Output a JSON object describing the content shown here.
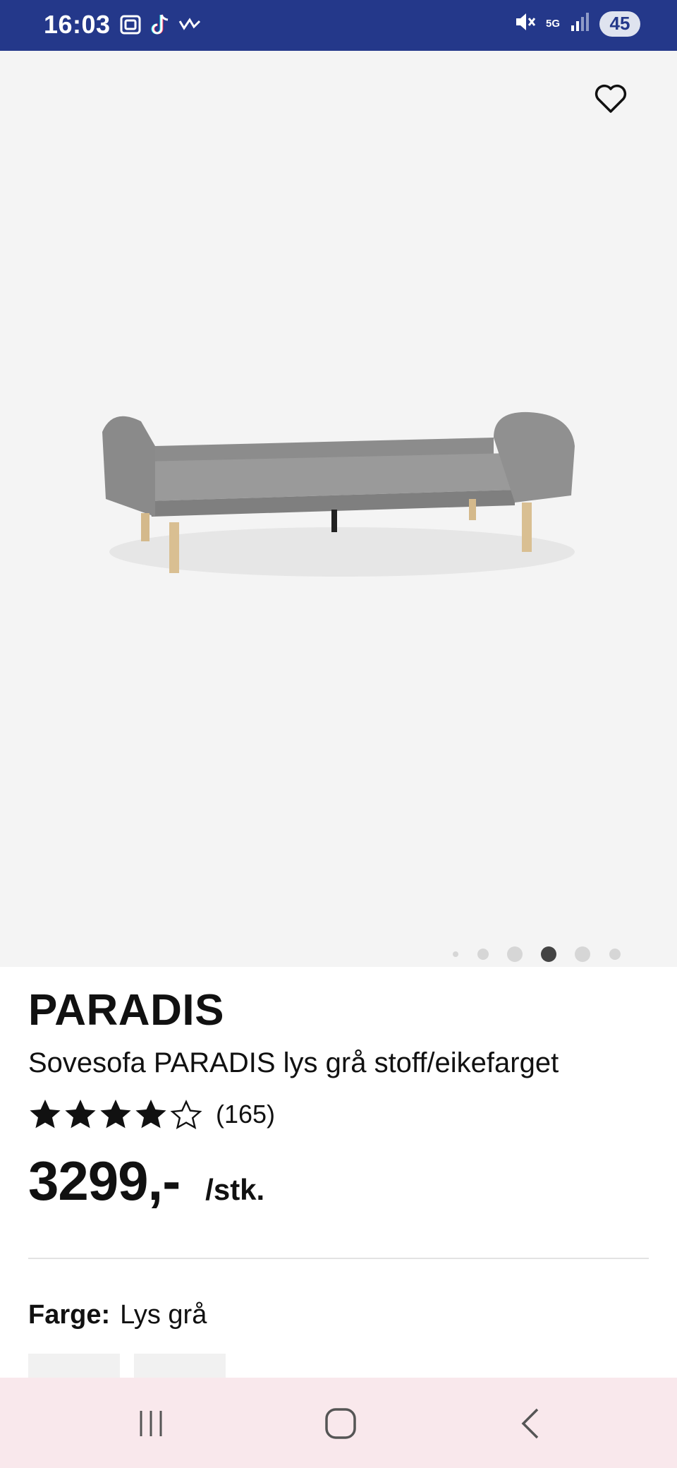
{
  "status_bar": {
    "time": "16:03",
    "network": "5G",
    "battery": "45",
    "icons": [
      "screenshot-icon",
      "tiktok-icon",
      "wave-icon",
      "mute-icon",
      "signal-icon"
    ]
  },
  "gallery": {
    "dots_count": 6,
    "active_index": 3,
    "favorite_icon": "heart-outline-icon"
  },
  "product": {
    "brand": "PARADIS",
    "title": "Sovesofa PARADIS lys grå stoff/eikefarget",
    "rating": 4,
    "rating_max": 5,
    "reviews": "(165)",
    "price": "3299,-",
    "unit": "/stk.",
    "color_label": "Farge:",
    "color_value": "Lys grå"
  },
  "nav": {
    "recent_icon": "recent-apps-icon",
    "home_icon": "home-icon",
    "back_icon": "back-icon"
  },
  "colors": {
    "status_bar": "#24388a",
    "nav_bar": "#f9e8ec",
    "gallery_bg": "#f4f4f4"
  }
}
